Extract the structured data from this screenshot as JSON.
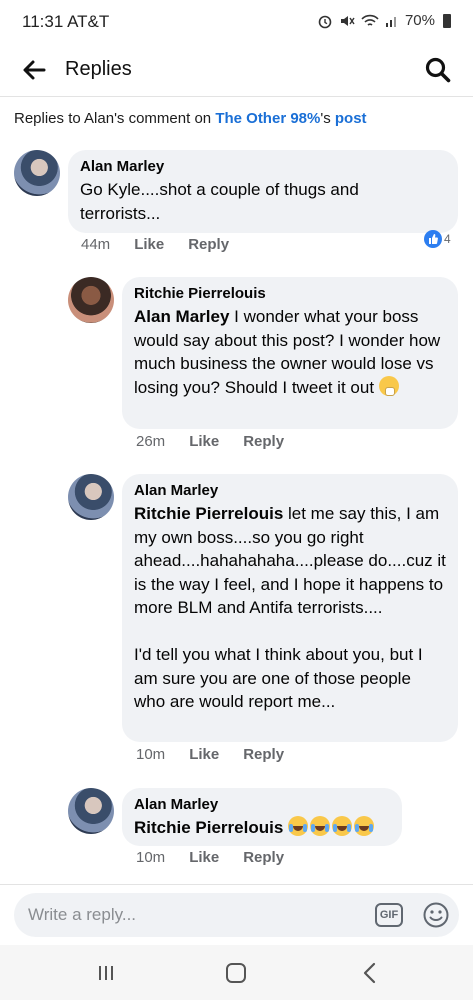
{
  "status_bar": {
    "time": "11:31 AT&T",
    "battery": "70%"
  },
  "header": {
    "title": "Replies"
  },
  "context": {
    "prefix": "Replies to Alan's comment on ",
    "page_name": "The Other 98%",
    "suffix": "'s ",
    "post_link": "post"
  },
  "comments": [
    {
      "author": "Alan Marley",
      "text": "Go Kyle....shot a couple of thugs and terrorists...",
      "time": "44m",
      "like_label": "Like",
      "reply_label": "Reply",
      "reaction_count": "4"
    },
    {
      "author": "Ritchie Pierrelouis",
      "tag": "Alan Marley",
      "text": " I wonder what your boss would say about this post? I wonder how much business the owner would lose vs losing you?  Should I tweet it out ",
      "time": "26m",
      "like_label": "Like",
      "reply_label": "Reply"
    },
    {
      "author": "Alan Marley",
      "tag": "Ritchie Pierrelouis",
      "text": " let me say this, I am my own boss....so you go right ahead....hahahahaha....please do....cuz it is the way I feel, and I hope it happens to more BLM and Antifa terrorists....\n\nI'd tell you what I think about you, but I am sure you are one of those people who are would report me...",
      "time": "10m",
      "like_label": "Like",
      "reply_label": "Reply"
    },
    {
      "author": "Alan Marley",
      "tag": "Ritchie Pierrelouis",
      "time": "10m",
      "like_label": "Like",
      "reply_label": "Reply"
    }
  ],
  "reply_bar": {
    "placeholder": "Write a reply...",
    "gif_label": "GIF"
  },
  "colors": {
    "link": "#1a6fd6",
    "bubble": "#f0f2f5",
    "meta": "#65676b",
    "like_badge": "#2d7ef0"
  }
}
